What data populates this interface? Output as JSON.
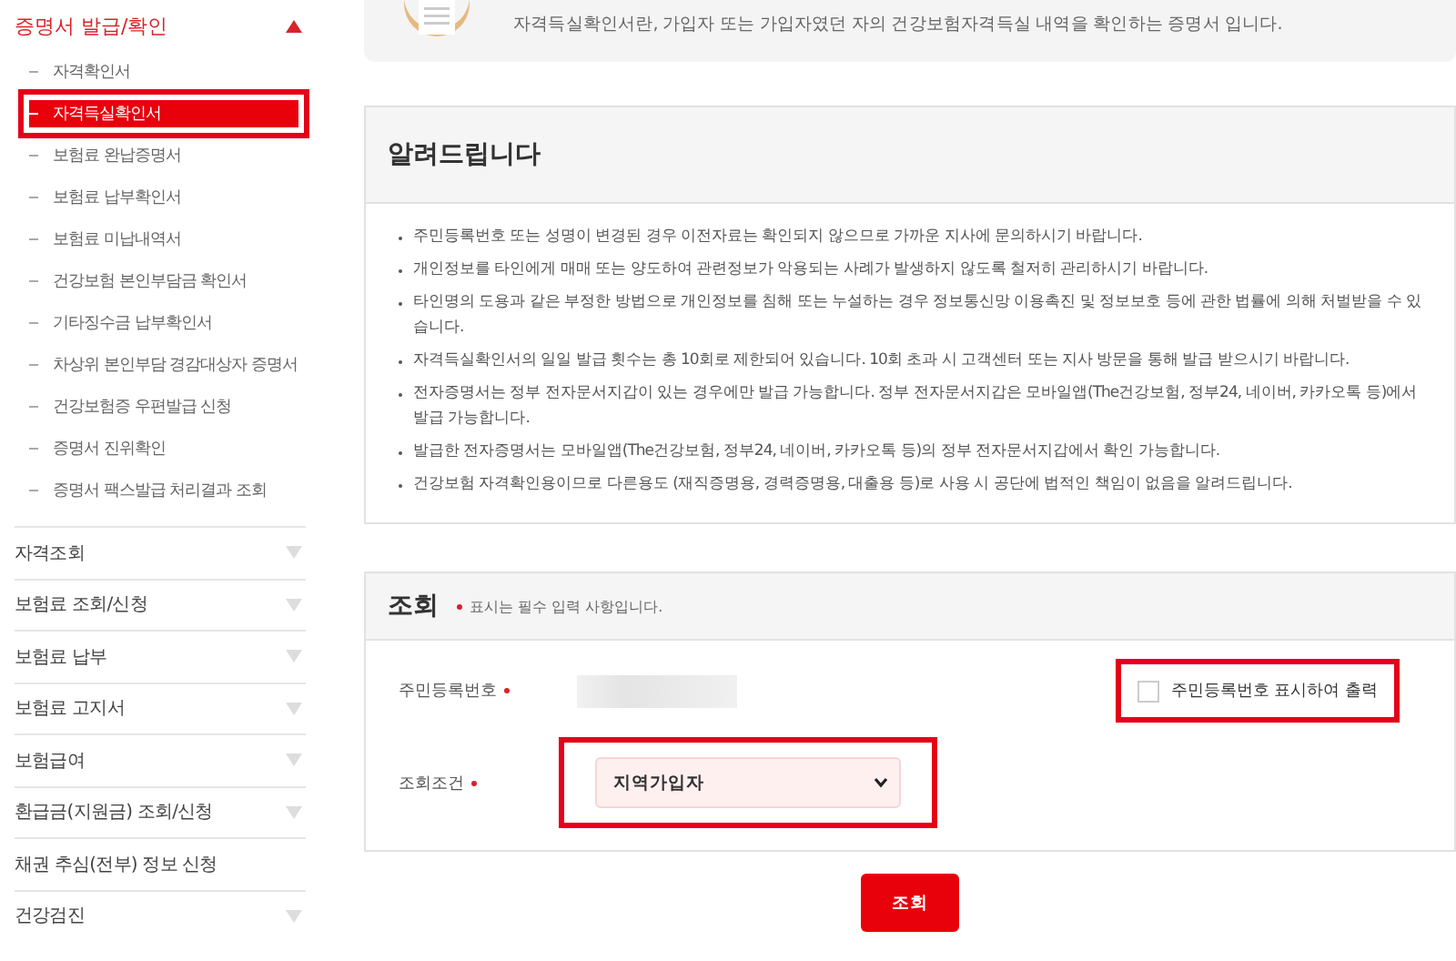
{
  "sidebar": {
    "group": {
      "label": "증명서 발급/확인",
      "expanded": true,
      "children": [
        {
          "label": "자격확인서",
          "selected": false,
          "highlighted": false
        },
        {
          "label": "자격득실확인서",
          "selected": true,
          "highlighted": true
        },
        {
          "label": "보험료 완납증명서",
          "selected": false,
          "highlighted": false
        },
        {
          "label": "보험료 납부확인서",
          "selected": false,
          "highlighted": false
        },
        {
          "label": "보험료 미납내역서",
          "selected": false,
          "highlighted": false
        },
        {
          "label": "건강보험 본인부담금 확인서",
          "selected": false,
          "highlighted": false
        },
        {
          "label": "기타징수금 납부확인서",
          "selected": false,
          "highlighted": false
        },
        {
          "label": "차상위 본인부담 경감대상자 증명서",
          "selected": false,
          "highlighted": false
        },
        {
          "label": "건강보험증 우편발급 신청",
          "selected": false,
          "highlighted": false
        },
        {
          "label": "증명서 진위확인",
          "selected": false,
          "highlighted": false
        },
        {
          "label": "증명서 팩스발급 처리결과 조회",
          "selected": false,
          "highlighted": false
        }
      ]
    },
    "sections": [
      {
        "label": "자격조회",
        "expandable": true
      },
      {
        "label": "보험료 조회/신청",
        "expandable": true
      },
      {
        "label": "보험료 납부",
        "expandable": true
      },
      {
        "label": "보험료 고지서",
        "expandable": true
      },
      {
        "label": "보험급여",
        "expandable": true
      },
      {
        "label": "환급금(지원금) 조회/신청",
        "expandable": true
      },
      {
        "label": "채권 추심(전부) 정보 신청",
        "expandable": false
      },
      {
        "label": "건강검진",
        "expandable": true
      }
    ]
  },
  "intro": {
    "text": "자격득실확인서란, 가입자 또는 가입자였던 자의 건강보험자격득실 내역을 확인하는 증명서 입니다."
  },
  "notice": {
    "title": "알려드립니다",
    "items": [
      "주민등록번호 또는 성명이 변경된 경우 이전자료는 확인되지 않으므로 가까운 지사에 문의하시기 바랍니다.",
      "개인정보를 타인에게 매매 또는 양도하여 관련정보가 악용되는 사례가 발생하지 않도록 철저히 관리하시기 바랍니다.",
      "타인명의 도용과 같은 부정한 방법으로 개인정보를 침해 또는 누설하는 경우 정보통신망 이용촉진 및 정보보호 등에 관한 법률에 의해 처벌받을 수 있습니다.",
      "자격득실확인서의 일일 발급 횟수는 총 10회로 제한되어 있습니다. 10회 초과 시 고객센터 또는 지사 방문을 통해 발급 받으시기 바랍니다.",
      "전자증명서는 정부 전자문서지갑이 있는 경우에만 발급 가능합니다. 정부 전자문서지갑은 모바일앱(The건강보험, 정부24, 네이버, 카카오톡 등)에서 발급 가능합니다.",
      "발급한 전자증명서는 모바일앱(The건강보험, 정부24, 네이버, 카카오톡 등)의 정부 전자문서지갑에서 확인 가능합니다.",
      "건강보험 자격확인용이므로 다른용도 (재직증명용, 경력증명용, 대출용 등)로 사용 시 공단에 법적인 책임이 없음을 알려드립니다."
    ]
  },
  "query": {
    "title": "조회",
    "required_note": "표시는 필수 입력 사항입니다.",
    "id_label": "주민등록번호",
    "id_masked": true,
    "checkbox": {
      "label": "주민등록번호 표시하여 출력",
      "checked": false,
      "highlighted": true
    },
    "condition_label": "조회조건",
    "condition": {
      "value": "지역가입자",
      "highlighted": true
    },
    "button": "조회"
  }
}
